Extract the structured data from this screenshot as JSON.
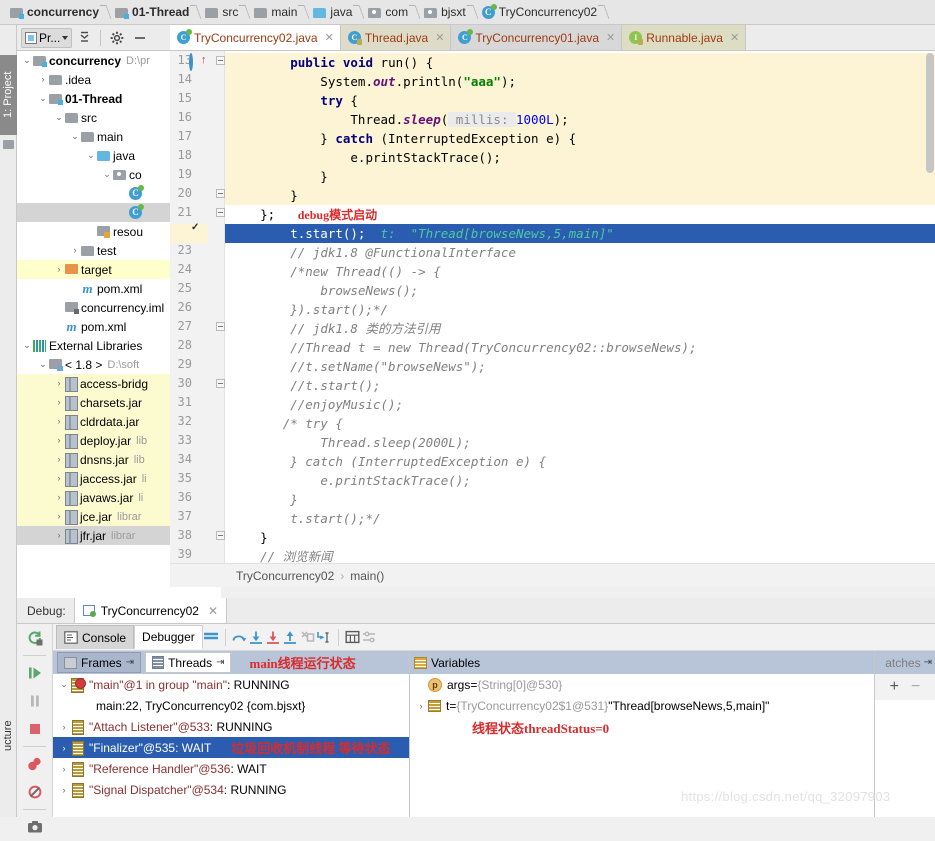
{
  "breadcrumb": [
    {
      "label": "concurrency",
      "icon": "module-folder-icon",
      "bold": true
    },
    {
      "label": "01-Thread",
      "icon": "module-folder-icon",
      "bold": true
    },
    {
      "label": "src",
      "icon": "folder-icon",
      "bold": false
    },
    {
      "label": "main",
      "icon": "folder-icon",
      "bold": false
    },
    {
      "label": "java",
      "icon": "source-folder-icon",
      "bold": false
    },
    {
      "label": "com",
      "icon": "package-icon",
      "bold": false
    },
    {
      "label": "bjsxt",
      "icon": "package-icon",
      "bold": false
    },
    {
      "label": "TryConcurrency02",
      "icon": "java-class-icon",
      "bold": false
    }
  ],
  "left_strip": {
    "project_label": "1: Project",
    "structure_label": "ucture"
  },
  "project_panel": {
    "title": "Pr...",
    "tree": [
      {
        "indent": 0,
        "arrow": "v",
        "icon": "module-folder-icon",
        "label": "concurrency",
        "sub": "D:\\pr",
        "bold": true,
        "hl": "none"
      },
      {
        "indent": 1,
        "arrow": ">",
        "icon": "folder-icon",
        "label": ".idea",
        "sub": "",
        "bold": false,
        "hl": "none"
      },
      {
        "indent": 1,
        "arrow": "v",
        "icon": "module-folder-icon",
        "label": "01-Thread",
        "sub": "",
        "bold": true,
        "hl": "none"
      },
      {
        "indent": 2,
        "arrow": "v",
        "icon": "folder-icon",
        "label": "src",
        "sub": "",
        "bold": false,
        "hl": "none"
      },
      {
        "indent": 3,
        "arrow": "v",
        "icon": "folder-icon",
        "label": "main",
        "sub": "",
        "bold": false,
        "hl": "none"
      },
      {
        "indent": 4,
        "arrow": "v",
        "icon": "source-folder-icon",
        "label": "java",
        "sub": "",
        "bold": false,
        "hl": "none"
      },
      {
        "indent": 5,
        "arrow": "v",
        "icon": "package-icon",
        "label": "co",
        "sub": "",
        "bold": false,
        "hl": "none"
      },
      {
        "indent": 6,
        "arrow": "",
        "icon": "java-class-icon",
        "label": "",
        "sub": "",
        "bold": false,
        "hl": "none"
      },
      {
        "indent": 6,
        "arrow": "",
        "icon": "java-class-icon",
        "label": "",
        "sub": "",
        "bold": false,
        "hl": "grey"
      },
      {
        "indent": 4,
        "arrow": "",
        "icon": "resource-folder-icon",
        "label": "resou",
        "sub": "",
        "bold": false,
        "hl": "none"
      },
      {
        "indent": 3,
        "arrow": ">",
        "icon": "folder-icon",
        "label": "test",
        "sub": "",
        "bold": false,
        "hl": "none"
      },
      {
        "indent": 2,
        "arrow": ">",
        "icon": "target-folder-icon",
        "label": "target",
        "sub": "",
        "bold": false,
        "hl": "yellow"
      },
      {
        "indent": 3,
        "arrow": "",
        "icon": "maven-icon",
        "label": "pom.xml",
        "sub": "",
        "bold": false,
        "hl": "none"
      },
      {
        "indent": 2,
        "arrow": "",
        "icon": "iml-icon",
        "label": "concurrency.iml",
        "sub": "",
        "bold": false,
        "hl": "none"
      },
      {
        "indent": 2,
        "arrow": "",
        "icon": "maven-icon",
        "label": "pom.xml",
        "sub": "",
        "bold": false,
        "hl": "none"
      },
      {
        "indent": 0,
        "arrow": "v",
        "icon": "libraries-icon",
        "label": "External Libraries",
        "sub": "",
        "bold": false,
        "hl": "none"
      },
      {
        "indent": 1,
        "arrow": "v",
        "icon": "sdk-icon",
        "label": "< 1.8 >",
        "sub": "D:\\soft",
        "bold": false,
        "hl": "none"
      },
      {
        "indent": 2,
        "arrow": ">",
        "icon": "jar-icon",
        "label": "access-bridg",
        "sub": "",
        "bold": false,
        "hl": "yellow2"
      },
      {
        "indent": 2,
        "arrow": ">",
        "icon": "jar-icon",
        "label": "charsets.jar",
        "sub": "",
        "bold": false,
        "hl": "yellow2"
      },
      {
        "indent": 2,
        "arrow": ">",
        "icon": "jar-icon",
        "label": "cldrdata.jar",
        "sub": "",
        "bold": false,
        "hl": "yellow2"
      },
      {
        "indent": 2,
        "arrow": ">",
        "icon": "jar-icon",
        "label": "deploy.jar",
        "sub": "lib",
        "bold": false,
        "hl": "yellow2"
      },
      {
        "indent": 2,
        "arrow": ">",
        "icon": "jar-icon",
        "label": "dnsns.jar",
        "sub": "lib",
        "bold": false,
        "hl": "yellow2"
      },
      {
        "indent": 2,
        "arrow": ">",
        "icon": "jar-icon",
        "label": "jaccess.jar",
        "sub": "li",
        "bold": false,
        "hl": "yellow2"
      },
      {
        "indent": 2,
        "arrow": ">",
        "icon": "jar-icon",
        "label": "javaws.jar",
        "sub": "li",
        "bold": false,
        "hl": "yellow2"
      },
      {
        "indent": 2,
        "arrow": ">",
        "icon": "jar-icon",
        "label": "jce.jar",
        "sub": "librar",
        "bold": false,
        "hl": "yellow2"
      },
      {
        "indent": 2,
        "arrow": ">",
        "icon": "jar-icon",
        "label": "jfr.jar",
        "sub": "librar",
        "bold": false,
        "hl": "grey"
      }
    ]
  },
  "editor_tabs": [
    {
      "label": "TryConcurrency02.java",
      "icon": "java-class-icon",
      "state": "active"
    },
    {
      "label": "Thread.java",
      "icon": "java-class-lib-icon",
      "state": "t1"
    },
    {
      "label": "TryConcurrency01.java",
      "icon": "java-class-icon",
      "state": "t2"
    },
    {
      "label": "Runnable.java",
      "icon": "java-interface-icon",
      "state": "t3"
    }
  ],
  "editor": {
    "first_line": 13,
    "last_line": 39,
    "lines": [
      {
        "n": 13,
        "html": "        <span class='kw'>public</span> <span class='kw'>void</span> run() {",
        "band": "yellow"
      },
      {
        "n": 14,
        "html": "            System.<span class='fld'>out</span>.println(<span class='str'>\"aaa\"</span>);",
        "band": "yellow"
      },
      {
        "n": 15,
        "html": "            <span class='kw'>try</span> {",
        "band": "yellow"
      },
      {
        "n": 16,
        "html": "                Thread.<span class='fld'>sleep</span>(<span class='hint'> millis: </span><span class='num'>1000L</span>);",
        "band": "yellow"
      },
      {
        "n": 17,
        "html": "            } <span class='kw'>catch</span> (InterruptedException e) {",
        "band": "yellow"
      },
      {
        "n": 18,
        "html": "                e.printStackTrace();",
        "band": "yellow"
      },
      {
        "n": 19,
        "html": "            }",
        "band": "yellow"
      },
      {
        "n": 20,
        "html": "        }",
        "band": "yellow"
      },
      {
        "n": 21,
        "html": "    };   <span class='annot'>debug模式启动</span>",
        "band": "none"
      },
      {
        "n": 22,
        "html": "        t.start();  <span class='inline-dbg'>t:  \"Thread[browseNews,5,main]\"</span>",
        "band": "selected"
      },
      {
        "n": 23,
        "html": "        <span class='cmt'>// jdk1.8 @FunctionalInterface</span>",
        "band": "none"
      },
      {
        "n": 24,
        "html": "        <span class='cmt'>/*new Thread(() -&gt; {</span>",
        "band": "none"
      },
      {
        "n": 25,
        "html": "            <span class='cmt'>browseNews();</span>",
        "band": "none"
      },
      {
        "n": 26,
        "html": "        <span class='cmt'>}).start();*/</span>",
        "band": "none"
      },
      {
        "n": 27,
        "html": "        <span class='cmt'>// jdk1.8 类的方法引用</span>",
        "band": "none"
      },
      {
        "n": 28,
        "html": "        <span class='cmt'>//Thread t = new Thread(TryConcurrency02::browseNews);</span>",
        "band": "none"
      },
      {
        "n": 29,
        "html": "        <span class='cmt'>//t.setName(\"browseNews\");</span>",
        "band": "none"
      },
      {
        "n": 30,
        "html": "        <span class='cmt'>//t.start();</span>",
        "band": "none"
      },
      {
        "n": 31,
        "html": "        <span class='cmt'>//enjoyMusic();</span>",
        "band": "none"
      },
      {
        "n": 32,
        "html": "       <span class='cmt'>/* try {</span>",
        "band": "none"
      },
      {
        "n": 33,
        "html": "            <span class='cmt'>Thread.sleep(2000L);</span>",
        "band": "none"
      },
      {
        "n": 34,
        "html": "        <span class='cmt'>} catch (InterruptedException e) {</span>",
        "band": "none"
      },
      {
        "n": 35,
        "html": "            <span class='cmt'>e.printStackTrace();</span>",
        "band": "none"
      },
      {
        "n": 36,
        "html": "        <span class='cmt'>}</span>",
        "band": "none"
      },
      {
        "n": 37,
        "html": "        <span class='cmt'>t.start();*/</span>",
        "band": "none"
      },
      {
        "n": 38,
        "html": "    }",
        "band": "none"
      },
      {
        "n": 39,
        "html": "    <span class='cmt'>// 浏览新闻</span>",
        "band": "none"
      }
    ],
    "breadcrumb": {
      "class": "TryConcurrency02",
      "sep": "›",
      "method": "main()"
    }
  },
  "debug_panel": {
    "header_label": "Debug:",
    "session_tab": "TryConcurrency02",
    "close": "✕",
    "toolbar": {
      "console_tab": "Console",
      "debugger_tab": "Debugger",
      "icons": [
        "layout-settings-icon",
        "step-over-icon",
        "step-into-icon",
        "force-step-into-icon",
        "step-out-icon",
        "drop-frame-icon",
        "run-to-cursor-icon",
        "evaluate-expression-icon",
        "mute-breakpoints-icon"
      ]
    },
    "side_icons": [
      "rerun-icon",
      "resume-program-icon",
      "pause-program-icon",
      "stop-icon",
      "view-breakpoints-icon",
      "mute-breakpoints-icon",
      "camera-icon"
    ],
    "frames_pane": {
      "frames_tab": "Frames",
      "threads_tab": "Threads",
      "annotation": "main线程运行状态",
      "threads": [
        {
          "arrow": "v",
          "icon": "thread-running-main-icon",
          "name": "\"main\"@1 in group \"main\"",
          "state": ": RUNNING",
          "selected": false,
          "annotation": ""
        },
        {
          "arrow": "",
          "icon": "stack-frame",
          "name": "main:22, TryConcurrency02 {com.bjsxt}",
          "state": "",
          "selected": false,
          "annotation": "",
          "is_stack": true
        },
        {
          "arrow": ">",
          "icon": "thread-icon",
          "name": "\"Attach Listener\"@533",
          "state": ": RUNNING",
          "selected": false,
          "annotation": ""
        },
        {
          "arrow": ">",
          "icon": "thread-icon",
          "name": "\"Finalizer\"@535",
          "state": ": WAIT",
          "selected": true,
          "annotation": "垃圾回收机制线程 等待状态"
        },
        {
          "arrow": ">",
          "icon": "thread-icon",
          "name": "\"Reference Handler\"@536",
          "state": ": WAIT",
          "selected": false,
          "annotation": ""
        },
        {
          "arrow": ">",
          "icon": "thread-icon",
          "name": "\"Signal Dispatcher\"@534",
          "state": ": RUNNING",
          "selected": false,
          "annotation": ""
        }
      ]
    },
    "variables_pane": {
      "title": "Variables",
      "watches_label": "atches",
      "add_button": "+",
      "remove_button": "−",
      "annotation": "线程状态threadStatus=0",
      "rows": [
        {
          "arrow": "",
          "icon": "parameter-icon",
          "name": "args",
          "eq": " = ",
          "value": "{String[0]@530}",
          "value_grey": true,
          "tail": ""
        },
        {
          "arrow": ">",
          "icon": "object-icon",
          "name": "t",
          "eq": " = ",
          "value": "{TryConcurrency02$1@531}",
          "value_grey": true,
          "tail": " \"Thread[browseNews,5,main]\""
        }
      ]
    }
  },
  "watermark": "https://blog.csdn.net/qq_32097903",
  "colors": {
    "selection_blue": "#2a5db0",
    "annotation_red": "#d92b2b",
    "yellow_band": "#fcf4d4",
    "pane_header": "#b8c4d8",
    "keyword": "#000080",
    "string": "#008000",
    "comment": "#808080"
  }
}
